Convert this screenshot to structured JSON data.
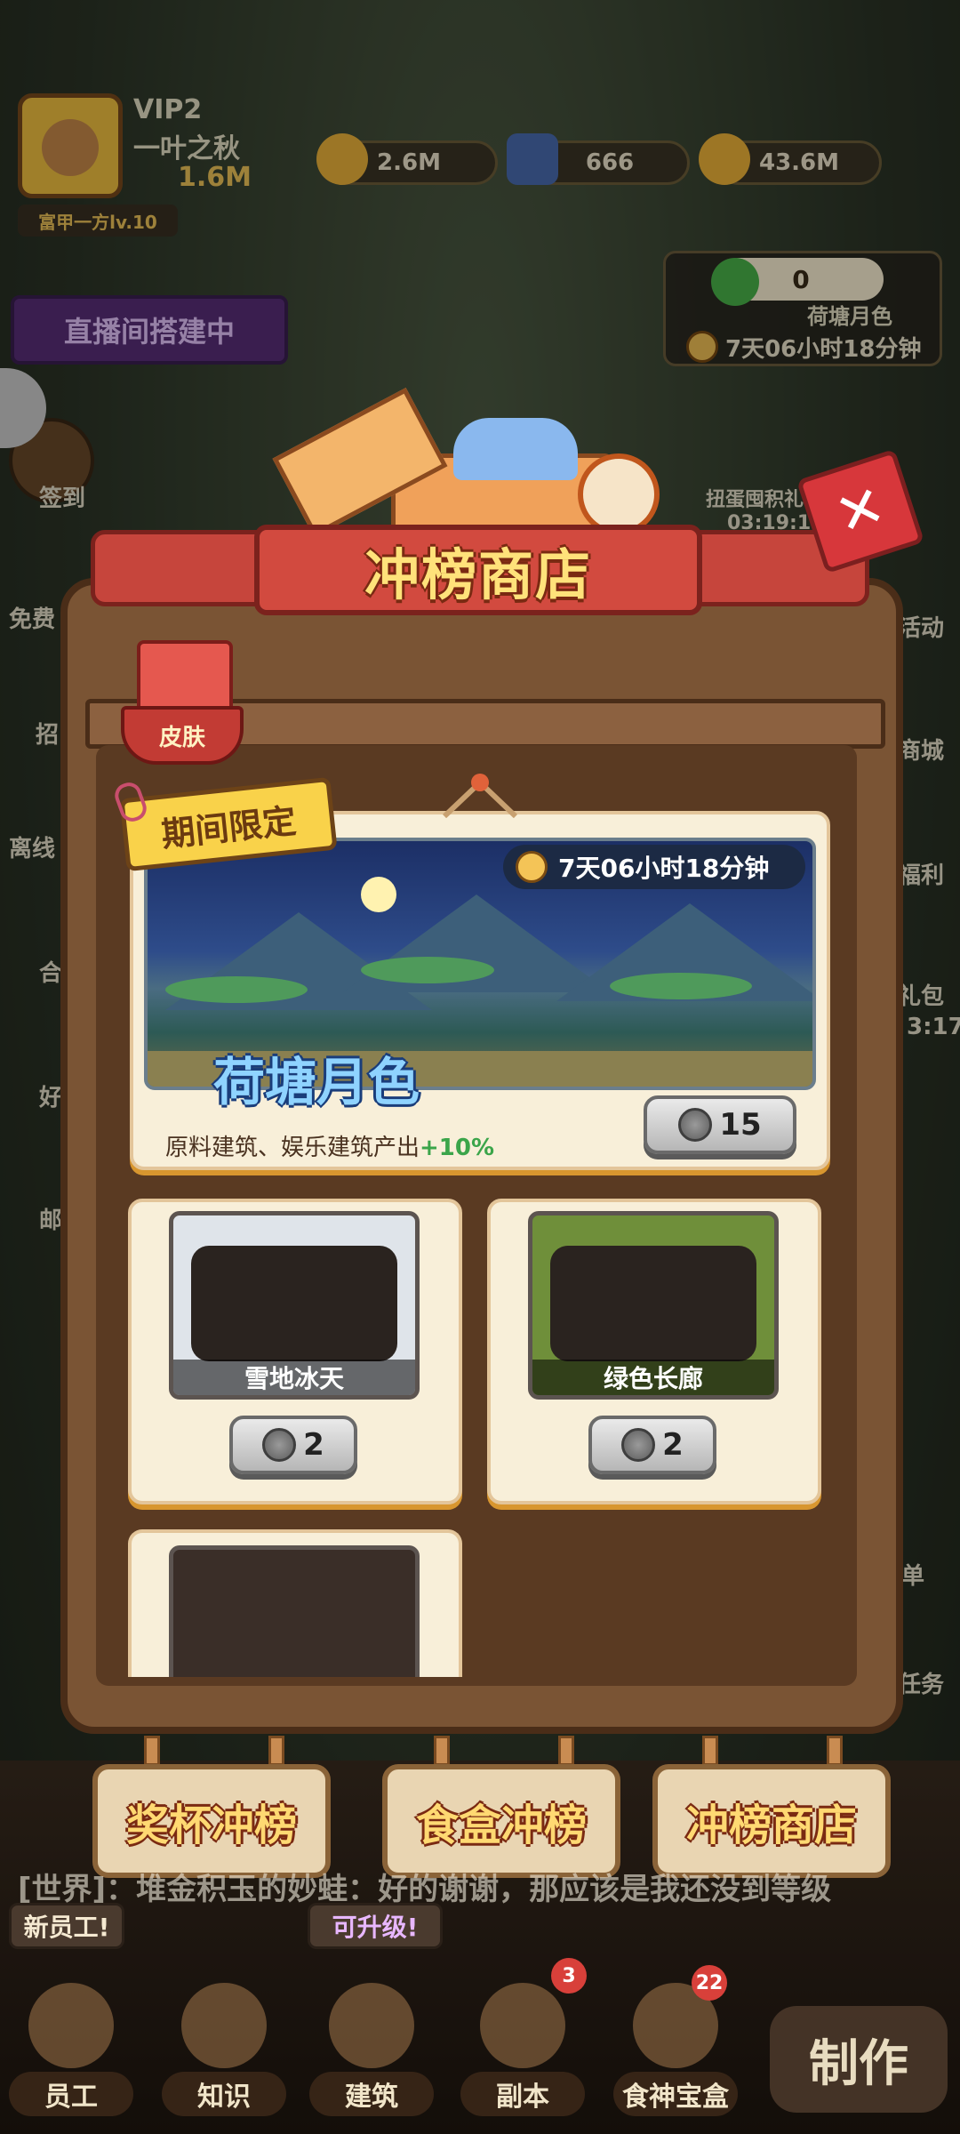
{
  "hud": {
    "vip": "VIP2",
    "player_name": "一叶之秋",
    "power": "1.6M",
    "rank_title": "富甲一方lv.10",
    "trophies": "2.6M",
    "gems": "666",
    "coins": "43.6M",
    "live_button": "直播间搭建中",
    "event_count": "0",
    "event_name": "荷塘月色",
    "event_timer": "7天06小时18分钟"
  },
  "side_left": [
    "签到",
    "免费",
    "招",
    "离线",
    "合",
    "好",
    "邮"
  ],
  "side_right": [
    "扭蛋囤积礼包",
    "03:19:14",
    "活动",
    "商城",
    "福利",
    "礼包",
    "3:17",
    "单",
    "任务"
  ],
  "shop": {
    "title": "冲榜商店",
    "tab_skin": "皮肤",
    "limited_tag": "期间限定",
    "featured": {
      "timer": "7天06小时18分钟",
      "name": "荷塘月色",
      "desc": "原料建筑、娱乐建筑产出",
      "bonus": "+10%",
      "price": "15"
    },
    "items": [
      {
        "name": "雪地冰天",
        "price": "2"
      },
      {
        "name": "绿色长廊",
        "price": "2"
      }
    ]
  },
  "bottom_tabs": [
    "奖杯冲榜",
    "食盒冲榜",
    "冲榜商店"
  ],
  "chat": "[世界]：堆金积玉的妙蛙：好的谢谢，那应该是我还没到等级",
  "bubbles": {
    "new_staff": "新员工!",
    "upgradable": "可升级!"
  },
  "nav": [
    {
      "label": "员工",
      "badge": ""
    },
    {
      "label": "知识",
      "badge": ""
    },
    {
      "label": "建筑",
      "badge": ""
    },
    {
      "label": "副本",
      "badge": "3"
    },
    {
      "label": "食神宝盒",
      "badge": "22"
    }
  ],
  "make_label": "制作",
  "colors": {
    "accent_red": "#c6453c",
    "title_yellow": "#ffe27a",
    "bonus_green": "#3ba54a"
  }
}
